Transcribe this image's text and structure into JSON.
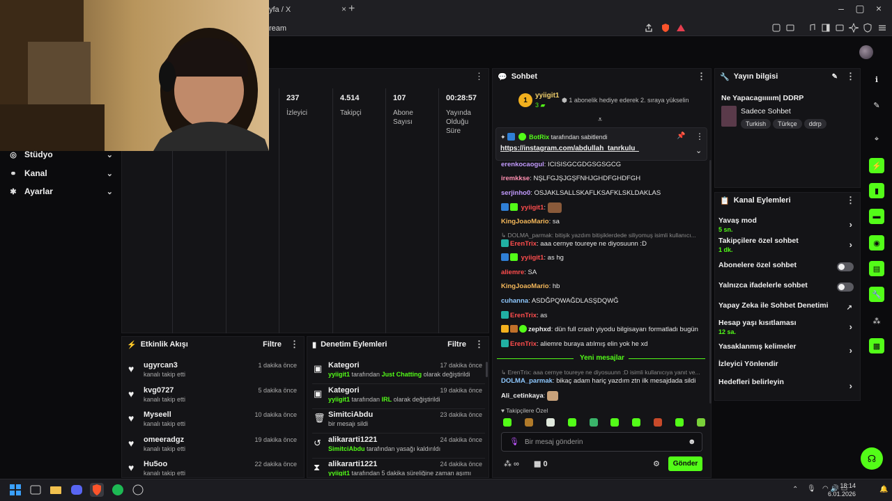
{
  "browser": {
    "tab_title": "yfa / X",
    "url_fragment": "ream"
  },
  "left_nav": [
    {
      "label": "Stüdyo",
      "icon": "studio-icon"
    },
    {
      "label": "Kanal",
      "icon": "channel-icon"
    },
    {
      "label": "Ayarlar",
      "icon": "gear-icon"
    }
  ],
  "stats": [
    {
      "value": "237",
      "label": "İzleyici"
    },
    {
      "value": "4.514",
      "label": "Takipçi"
    },
    {
      "value": "107",
      "label": "Abone Sayısı"
    },
    {
      "value": "00:28:57",
      "label": "Yayında Olduğu Süre"
    }
  ],
  "activity": {
    "title": "Etkinlik Akışı",
    "filter": "Filtre",
    "items": [
      {
        "name": "ugyrcan3",
        "sub": "kanalı takip etti",
        "time": "1 dakika önce"
      },
      {
        "name": "kvg0727",
        "sub": "kanalı takip etti",
        "time": "5 dakika önce"
      },
      {
        "name": "Myseell",
        "sub": "kanalı takip etti",
        "time": "10 dakika önce"
      },
      {
        "name": "omeeradgz",
        "sub": "kanalı takip etti",
        "time": "19 dakika önce"
      },
      {
        "name": "Hu5oo",
        "sub": "kanalı takip etti",
        "time": "22 dakika önce"
      }
    ]
  },
  "moderation": {
    "title": "Denetim Eylemleri",
    "filter": "Filtre",
    "items": [
      {
        "name": "Kategori",
        "actor": "yyiigit1",
        "mid": " tarafından ",
        "target": "Just Chatting",
        "tail": " olarak değiştirildi",
        "time": "17 dakika önce"
      },
      {
        "name": "Kategori",
        "actor": "yyiigit1",
        "mid": " tarafından ",
        "target": "IRL",
        "tail": " olarak değiştirildi",
        "time": "19 dakika önce"
      },
      {
        "name": "SimitciAbdu",
        "actor": "",
        "mid": "bir mesajı sildi",
        "target": "",
        "tail": "",
        "time": "23 dakika önce"
      },
      {
        "name": "alikararti1221",
        "actor": "SimitciAbdu",
        "mid": " tarafından yasağı kaldırıldı",
        "target": "",
        "tail": "",
        "time": "24 dakika önce"
      },
      {
        "name": "alikararti1221",
        "actor": "yyiigit1",
        "mid": " tarafından 5 dakika süreliğine zaman aşımı",
        "target": "",
        "tail": "",
        "time": "24 dakika önce"
      }
    ]
  },
  "chat": {
    "title": "Sohbet",
    "top_gifter": {
      "rank": "1",
      "name": "yyiigit1",
      "count": "3"
    },
    "gift_prompt": "1 abonelik hediye ederek 2. sıraya yükselin",
    "pinned": {
      "by": "BotRix",
      "by_suffix": " tarafından sabitlendi",
      "link": "https://instagram.com/abdullah_tanrkulu_"
    },
    "messages": [
      {
        "user": "erenkocaogul",
        "color": "#c39bff",
        "text": ": ICISISGCGDGSGSGCG"
      },
      {
        "user": "iremkkse",
        "color": "#ff8fb0",
        "text": ": NŞLFGJŞJGŞFNHJGHDFGHDFGH"
      },
      {
        "user": "serjinho0",
        "color": "#c39bff",
        "text": ": OSJAKLSALLSKAFLKSAFKLSKLDAKLAS"
      },
      {
        "user": "yyiigit1",
        "color": "#ff4d4d",
        "text": ":"
      },
      {
        "user": "KingJoaoMario",
        "color": "#f5b85a",
        "text": ": sa"
      },
      {
        "user": "DOLMA_parmak",
        "color": "#8a8a8a",
        "text": ": bitişik yazdım bitişiklerdede siliyomuş isimli kullanıcı..."
      },
      {
        "user": "ErenTrix",
        "color": "#ff4d4d",
        "text": ": aaa cernye toureye ne diyosuunn :D"
      },
      {
        "user": "yyiigit1",
        "color": "#ff4d4d",
        "text": ": as hg"
      },
      {
        "user": "aliemre",
        "color": "#ff4d4d",
        "text": ": SA"
      },
      {
        "user": "KingJoaoMario",
        "color": "#f5b85a",
        "text": ": hb"
      },
      {
        "user": "cuhanna",
        "color": "#8ec8ff",
        "text": ": ASDĞPQWAĞDLASŞDQWĞ"
      },
      {
        "user": "ErenTrix",
        "color": "#ff4d4d",
        "text": ": as"
      },
      {
        "user": "zephxd",
        "color": "#f0f0f0",
        "text": ": dün full crash yiyodu bilgisayarı formatladı bugün"
      },
      {
        "user": "ErenTrix",
        "color": "#ff4d4d",
        "text": ": aliemre buraya atılmış elin yok he xd"
      }
    ],
    "new_messages": "Yeni mesajlar",
    "messages_after": [
      {
        "user": "ErenTrix",
        "color": "#8a8a8a",
        "text": ": aaa cernye toureye ne diyosuunn :D isimli kullanıcıya yanıt ve..."
      },
      {
        "user": "DOLMA_parmak",
        "color": "#8ec8ff",
        "text": ": bikaç adam hariç yazdım ztn ilk mesajdada sildi"
      },
      {
        "user": "Ali_cetinkaya",
        "color": "#f0f0f0",
        "text": ":"
      }
    ],
    "followers_only_label": "Takipçilere Özel",
    "input_placeholder": "Bir mesaj gönderin",
    "box_count": "0",
    "send": "Gönder"
  },
  "stream_info": {
    "title": "Yayın bilgisi",
    "stream_title": "Ne Yapacagııııım| DDRP",
    "category": "Sadece Sohbet",
    "tags": [
      "Turkish",
      "Türkçe",
      "ddrp"
    ]
  },
  "channel_actions": {
    "title": "Kanal Eylemleri",
    "items": [
      {
        "label": "Yavaş mod",
        "sub": "5 sn.",
        "control": "chevron"
      },
      {
        "label": "Takipçilere özel sohbet",
        "sub": "1 dk.",
        "control": "chevron"
      },
      {
        "label": "Abonelere özel sohbet",
        "sub": "",
        "control": "toggle"
      },
      {
        "label": "Yalnızca ifadelerle sohbet",
        "sub": "",
        "control": "toggle"
      },
      {
        "label": "Yapay Zeka ile Sohbet Denetimi",
        "sub": "",
        "control": "external"
      },
      {
        "label": "Hesap yaşı kısıtlaması",
        "sub": "12 sa.",
        "control": "chevron"
      },
      {
        "label": "Yasaklanmış kelimeler",
        "sub": "",
        "control": "chevron"
      },
      {
        "label": "İzleyici Yönlendir",
        "sub": "",
        "control": "none"
      },
      {
        "label": "Hedefleri belirleyin",
        "sub": "",
        "control": "chevron"
      }
    ]
  },
  "taskbar": {
    "time": "18:14",
    "date": "6.01.2026"
  },
  "colors": {
    "accent": "#53fc18",
    "panel": "#141417",
    "background": "#0b0b0d"
  }
}
